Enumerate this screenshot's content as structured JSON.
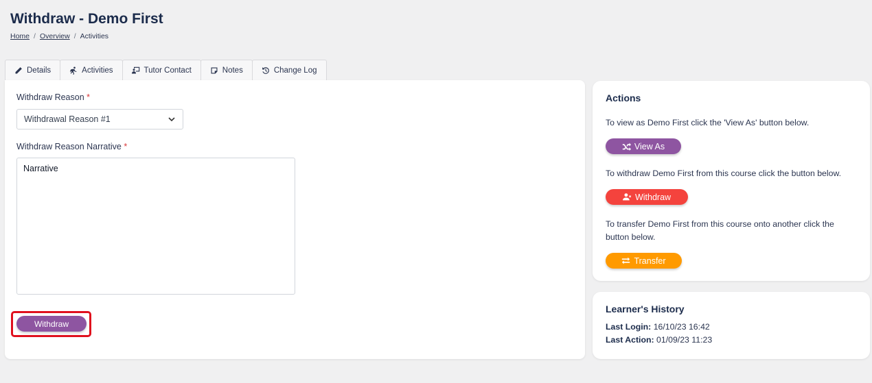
{
  "page": {
    "title": "Withdraw - Demo First"
  },
  "breadcrumb": {
    "home": "Home",
    "overview": "Overview",
    "current": "Activities",
    "separator": "/"
  },
  "tabs": [
    {
      "label": "Details",
      "icon": "pencil-icon"
    },
    {
      "label": "Activities",
      "icon": "running-icon"
    },
    {
      "label": "Tutor Contact",
      "icon": "chalkboard-user-icon"
    },
    {
      "label": "Notes",
      "icon": "note-icon"
    },
    {
      "label": "Change Log",
      "icon": "history-icon"
    }
  ],
  "form": {
    "reason_label": "Withdraw Reason",
    "required_mark": "*",
    "reason_value": "Withdrawal Reason #1",
    "narrative_label": "Withdraw Reason Narrative",
    "narrative_value": "Narrative",
    "submit_label": "Withdraw"
  },
  "actions": {
    "title": "Actions",
    "view_as_text": "To view as Demo First click the 'View As' button below.",
    "view_as_label": "View As",
    "withdraw_text": "To withdraw Demo First from this course click the button below.",
    "withdraw_label": "Withdraw",
    "transfer_text": "To transfer Demo First from this course onto another click the button below.",
    "transfer_label": "Transfer"
  },
  "history": {
    "title": "Learner's History",
    "last_login_label": "Last Login:",
    "last_login_value": "16/10/23 16:42",
    "last_action_label": "Last Action:",
    "last_action_value": "01/09/23 11:23"
  },
  "colors": {
    "purple": "#8e55a1",
    "red": "#f4433d",
    "orange": "#ff9a00",
    "highlight": "#e0101d"
  }
}
